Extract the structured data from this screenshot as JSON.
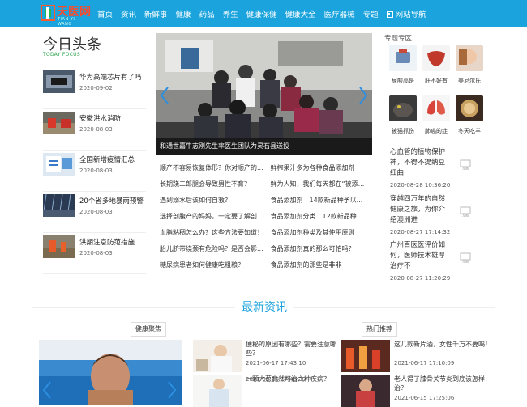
{
  "header": {
    "logo_text": "天医网",
    "logo_sub": "TIAN YI WANG",
    "nav": [
      "首页",
      "资讯",
      "新鲜事",
      "健康",
      "药品",
      "养生",
      "健康保健",
      "健康大全",
      "医疗器械",
      "专题"
    ],
    "nav_site": "网站导航",
    "bar_color": "#1aa3dc"
  },
  "headlines": {
    "title": "今日头条",
    "subtitle": "TODAY FOCUS",
    "items": [
      {
        "title": "华为高端芯片有了吗",
        "date": "2020-09-02"
      },
      {
        "title": "安徽洪水消防",
        "date": "2020-08-03"
      },
      {
        "title": "全国新增疫情汇总",
        "date": "2020-08-03"
      },
      {
        "title": "20个省多地暴雨预警",
        "date": "2020-08-03"
      },
      {
        "title": "洪期注意防范措施",
        "date": "2020-08-03"
      }
    ]
  },
  "carousel": {
    "caption": "和通世嘉牛志刚先生率医生团队为灵石县送投"
  },
  "links": [
    [
      "顺产不容易恢复体形？你对顺产的...",
      "鲜榨果汁多为各种食品添加剂"
    ],
    [
      "长期跷二郎腿会导致男性不育？",
      "鲜为人知，我们每天都在“被添..."
    ],
    [
      "遇到溺水后该如何自救？",
      "食品添加剂｜14款新品种予以..."
    ],
    [
      "选择剖腹产的妈妈，一定要了解剖...",
      "食品添加剂分类｜12款新品种..."
    ],
    [
      "血脂粘稠怎么办？这些方法要知道！",
      "食品添加剂种类及其使用原则"
    ],
    [
      "胎儿脐带绕颈有危险吗？是否会影...",
      "食品添加剂真的那么可怕吗？"
    ],
    [
      "糖尿病患者如何健康吃粗粮？",
      "食品添加剂的那些是非非"
    ]
  ],
  "topics": {
    "title": "专题专区",
    "items": [
      "尿酸高是",
      "肝不好有",
      "美尼尔氏",
      "被猫抓伤",
      "肺癌的症",
      "冬天吃羊"
    ]
  },
  "right_news": [
    {
      "title": "心血管的植物保护神，不得不提纳豆红曲",
      "date": "2020-08-28 10:36:20"
    },
    {
      "title": "穿越四万年的自然健康之旅，为你介绍澳洲进",
      "date": "2020-08-27 17:14:32"
    },
    {
      "title": "广州百医医评价如何，医师技术雄厚治疗不",
      "date": "2020-08-27 11:20:29"
    }
  ],
  "img_placeholder": "无图",
  "latest": {
    "title": "最新资讯",
    "tag_left": "健康聚焦",
    "tag_right": "热门推荐"
  },
  "bottom_mid": [
    {
      "title": "便秘的原因有哪些？需要注意哪些？",
      "date": "2021-06-17 17:43:10"
    },
    {
      "title": "一颗大葱竟然可治六种疾病？",
      "date": "2021-06-16 17:48:39"
    }
  ],
  "bottom_right": [
    {
      "title": "这几款新片酒，女性千万不要喝！",
      "date": "2021-06-17 17:10:09"
    },
    {
      "title": "老人得了膝骨关节炎到底该怎样治？",
      "date": "2021-06-15 17:25:06"
    }
  ]
}
